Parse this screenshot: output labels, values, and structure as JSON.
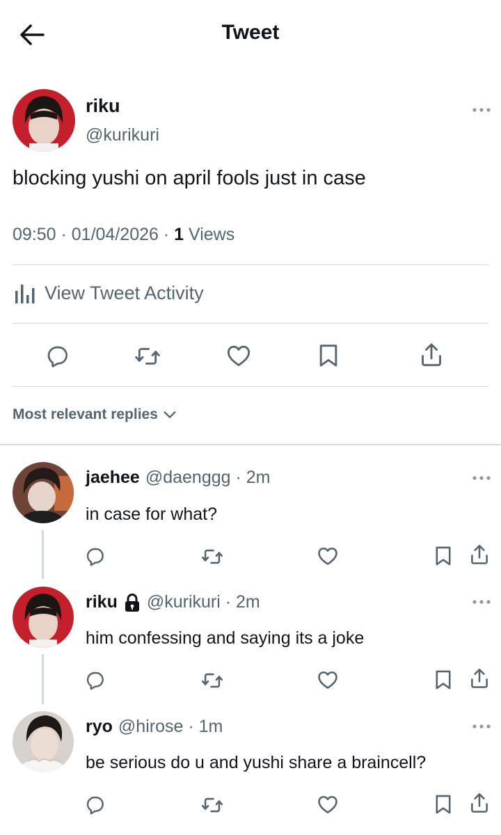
{
  "header": {
    "title": "Tweet"
  },
  "tweet": {
    "name": "riku",
    "handle": "@kurikuri",
    "text": "blocking yushi on april fools just in case",
    "time_date": "09:50 · 01/04/2026 · ",
    "views_count": "1",
    "views_label": " Views",
    "activity_label": "View Tweet Activity"
  },
  "replies_sort": {
    "label": "Most relevant replies"
  },
  "replies": [
    {
      "name": "jaehee",
      "handle": "@daenggg · 2m",
      "text": "in case for what?"
    },
    {
      "name": "riku",
      "handle": "@kurikuri · 2m",
      "text": "him confessing and saying its a joke",
      "protected": true
    },
    {
      "name": "ryo",
      "handle": "@hirose · 1m",
      "text": "be serious do u and yushi share a braincell?"
    }
  ],
  "icons": {
    "back": "arrow-left-icon",
    "more": "more-dots-icon",
    "activity": "bar-chart-icon",
    "reply": "reply-bubble-icon",
    "retweet": "retweet-icon",
    "like": "heart-icon",
    "bookmark": "bookmark-icon",
    "share": "share-icon",
    "lock": "lock-icon",
    "sort": "chevron-down-icon"
  },
  "colors": {
    "text": "#0f1419",
    "secondary": "#536471",
    "divider": "#d4d9dd",
    "thread": "#cfd9de"
  }
}
